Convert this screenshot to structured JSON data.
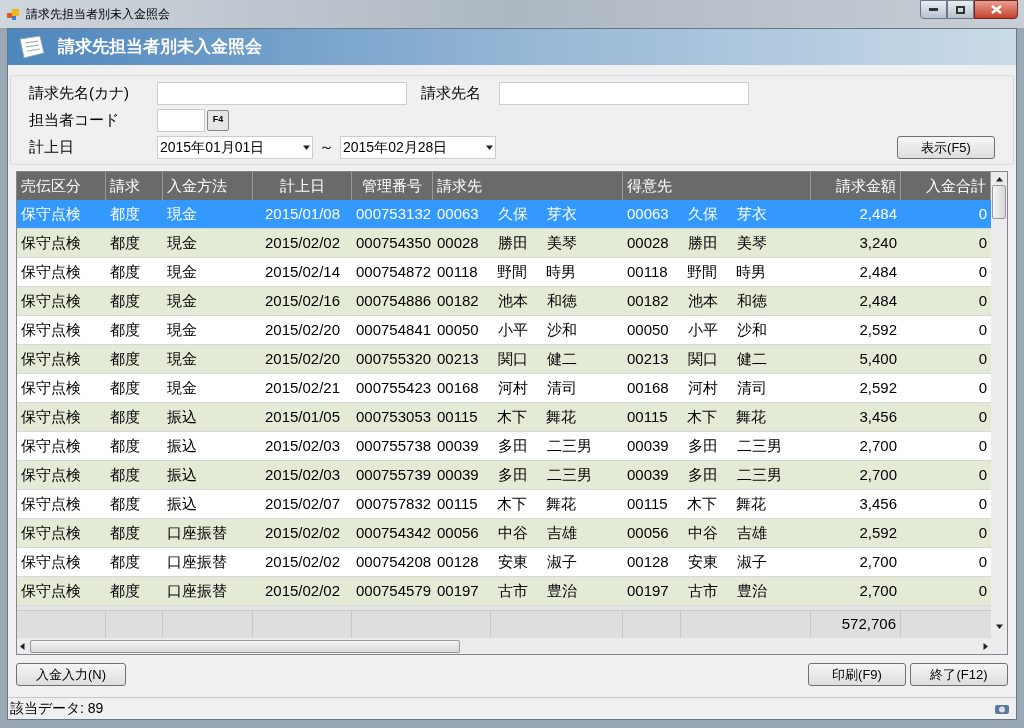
{
  "window": {
    "title": "請求先担当者別未入金照会"
  },
  "banner": {
    "title": "請求先担当者別未入金照会"
  },
  "filters": {
    "kana_label": "請求先名(カナ)",
    "name_label": "請求先名",
    "staff_label": "担当者コード",
    "lookup_button": "F4",
    "date_label": "計上日",
    "date_from": "2015年01月01日",
    "range_sep": "～",
    "date_to": "2015年02月28日",
    "show_button": "表示(F5)"
  },
  "table": {
    "columns": [
      "売伝区分",
      "請求",
      "入金方法",
      "計上日",
      "管理番号",
      "請求先",
      "得意先",
      "請求金額",
      "入金合計"
    ],
    "rows": [
      {
        "selected": true,
        "cells": [
          "保守点検",
          "都度",
          "現金",
          "2015/01/08",
          "000753132",
          "00063　 久保　 芽衣",
          "00063　 久保　 芽衣",
          "2,484",
          "0"
        ]
      },
      {
        "selected": false,
        "cells": [
          "保守点検",
          "都度",
          "現金",
          "2015/02/02",
          "000754350",
          "00028　 勝田　 美琴",
          "00028　 勝田　 美琴",
          "3,240",
          "0"
        ]
      },
      {
        "selected": false,
        "cells": [
          "保守点検",
          "都度",
          "現金",
          "2015/02/14",
          "000754872",
          "00118　 野間　 時男",
          "00118　 野間　 時男",
          "2,484",
          "0"
        ]
      },
      {
        "selected": false,
        "cells": [
          "保守点検",
          "都度",
          "現金",
          "2015/02/16",
          "000754886",
          "00182　 池本　 和徳",
          "00182　 池本　 和徳",
          "2,484",
          "0"
        ]
      },
      {
        "selected": false,
        "cells": [
          "保守点検",
          "都度",
          "現金",
          "2015/02/20",
          "000754841",
          "00050　 小平　 沙和",
          "00050　 小平　 沙和",
          "2,592",
          "0"
        ]
      },
      {
        "selected": false,
        "cells": [
          "保守点検",
          "都度",
          "現金",
          "2015/02/20",
          "000755320",
          "00213　 関口　 健二",
          "00213　 関口　 健二",
          "5,400",
          "0"
        ]
      },
      {
        "selected": false,
        "cells": [
          "保守点検",
          "都度",
          "現金",
          "2015/02/21",
          "000755423",
          "00168　 河村　 清司",
          "00168　 河村　 清司",
          "2,592",
          "0"
        ]
      },
      {
        "selected": false,
        "cells": [
          "保守点検",
          "都度",
          "振込",
          "2015/01/05",
          "000753053",
          "00115　 木下　 舞花",
          "00115　 木下　 舞花",
          "3,456",
          "0"
        ]
      },
      {
        "selected": false,
        "cells": [
          "保守点検",
          "都度",
          "振込",
          "2015/02/03",
          "000755738",
          "00039　 多田　 二三男",
          "00039　 多田　 二三男",
          "2,700",
          "0"
        ]
      },
      {
        "selected": false,
        "cells": [
          "保守点検",
          "都度",
          "振込",
          "2015/02/03",
          "000755739",
          "00039　 多田　 二三男",
          "00039　 多田　 二三男",
          "2,700",
          "0"
        ]
      },
      {
        "selected": false,
        "cells": [
          "保守点検",
          "都度",
          "振込",
          "2015/02/07",
          "000757832",
          "00115　 木下　 舞花",
          "00115　 木下　 舞花",
          "3,456",
          "0"
        ]
      },
      {
        "selected": false,
        "cells": [
          "保守点検",
          "都度",
          "口座振替",
          "2015/02/02",
          "000754342",
          "00056　 中谷　 吉雄",
          "00056　 中谷　 吉雄",
          "2,592",
          "0"
        ]
      },
      {
        "selected": false,
        "cells": [
          "保守点検",
          "都度",
          "口座振替",
          "2015/02/02",
          "000754208",
          "00128　 安東　 淑子",
          "00128　 安東　 淑子",
          "2,700",
          "0"
        ]
      },
      {
        "selected": false,
        "cells": [
          "保守点検",
          "都度",
          "口座振替",
          "2015/02/02",
          "000754579",
          "00197　 古市　 豊治",
          "00197　 古市　 豊治",
          "2,700",
          "0"
        ]
      }
    ],
    "total": "572,706"
  },
  "buttons": {
    "deposit": "入金入力(N)",
    "print": "印刷(F9)",
    "exit": "終了(F12)"
  },
  "status_bar": {
    "text": "該当データ: 89"
  }
}
